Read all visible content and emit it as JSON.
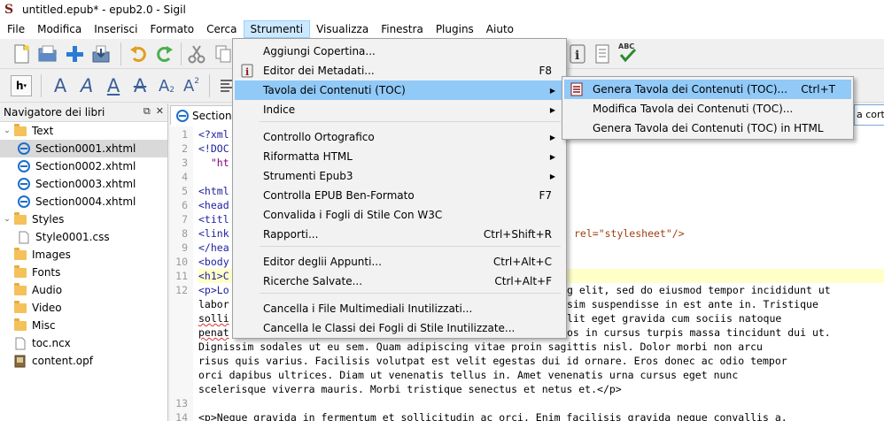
{
  "window": {
    "title": "untitled.epub* - epub2.0 - Sigil"
  },
  "menubar": [
    "File",
    "Modifica",
    "Inserisci",
    "Formato",
    "Cerca",
    "Strumenti",
    "Visualizza",
    "Finestra",
    "Plugins",
    "Aiuto"
  ],
  "active_menu": "Strumenti",
  "strumenti_menu": [
    {
      "label": "Aggiungi Copertina...",
      "shortcut": "",
      "submenu": false,
      "icon": ""
    },
    {
      "label": "Editor dei Metadati...",
      "shortcut": "F8",
      "submenu": false,
      "icon": "info-icon"
    },
    {
      "label": "Tavola dei Contenuti (TOC)",
      "shortcut": "",
      "submenu": true,
      "icon": ""
    },
    {
      "label": "Indice",
      "shortcut": "",
      "submenu": true,
      "icon": ""
    },
    {
      "label": "Controllo Ortografico",
      "shortcut": "",
      "submenu": true,
      "icon": ""
    },
    {
      "label": "Riformatta HTML",
      "shortcut": "",
      "submenu": true,
      "icon": ""
    },
    {
      "label": "Strumenti Epub3",
      "shortcut": "",
      "submenu": true,
      "icon": ""
    },
    {
      "label": "Controlla EPUB Ben-Formato",
      "shortcut": "F7",
      "submenu": false,
      "icon": ""
    },
    {
      "label": "Convalida i Fogli di Stile Con W3C",
      "shortcut": "",
      "submenu": false,
      "icon": ""
    },
    {
      "label": "Rapporti...",
      "shortcut": "Ctrl+Shift+R",
      "submenu": false,
      "icon": ""
    },
    {
      "label": "Editor deglii Appunti...",
      "shortcut": "Ctrl+Alt+C",
      "submenu": false,
      "icon": ""
    },
    {
      "label": "Ricerche Salvate...",
      "shortcut": "Ctrl+Alt+F",
      "submenu": false,
      "icon": ""
    },
    {
      "label": "Cancella i File Multimediali Inutilizzati...",
      "shortcut": "",
      "submenu": false,
      "icon": ""
    },
    {
      "label": "Cancella le Classi dei Fogli di Stile Inutilizzate...",
      "shortcut": "",
      "submenu": false,
      "icon": ""
    }
  ],
  "toc_submenu": [
    {
      "label": "Genera Tavola dei Contenuti (TOC)...",
      "shortcut": "Ctrl+T",
      "icon": "toc-icon"
    },
    {
      "label": "Modifica Tavola dei Contenuti (TOC)...",
      "shortcut": ""
    },
    {
      "label": "Genera Tavola dei Contenuti (TOC) in HTML",
      "shortcut": ""
    }
  ],
  "navigator": {
    "title": "Navigatore dei libri",
    "items": [
      {
        "label": "Text",
        "type": "folder",
        "level": 0,
        "expanded": true
      },
      {
        "label": "Section0001.xhtml",
        "type": "xhtml",
        "level": 1,
        "selected": true
      },
      {
        "label": "Section0002.xhtml",
        "type": "xhtml",
        "level": 1
      },
      {
        "label": "Section0003.xhtml",
        "type": "xhtml",
        "level": 1
      },
      {
        "label": "Section0004.xhtml",
        "type": "xhtml",
        "level": 1
      },
      {
        "label": "Styles",
        "type": "folder",
        "level": 0,
        "expanded": true
      },
      {
        "label": "Style0001.css",
        "type": "css",
        "level": 1
      },
      {
        "label": "Images",
        "type": "folder",
        "level": 0
      },
      {
        "label": "Fonts",
        "type": "folder",
        "level": 0
      },
      {
        "label": "Audio",
        "type": "folder",
        "level": 0
      },
      {
        "label": "Video",
        "type": "folder",
        "level": 0
      },
      {
        "label": "Misc",
        "type": "folder",
        "level": 0
      },
      {
        "label": "toc.ncx",
        "type": "ncx",
        "level": 0
      },
      {
        "label": "content.opf",
        "type": "opf",
        "level": 0
      }
    ]
  },
  "editor": {
    "tab_label": "Section",
    "search_stub": "a corte",
    "line_numbers": [
      "1",
      "2",
      "3",
      "4",
      "5",
      "6",
      "7",
      "8",
      "9",
      "10",
      "11",
      "12",
      "",
      "",
      "",
      "",
      "",
      "",
      "",
      "13",
      "14"
    ],
    "visible_code": {
      "l1": "<?xml",
      "l2": "<!DOC",
      "l3": "  \"ht",
      "l5": "<html",
      "l6": "<head",
      "l7": "<titl",
      "l8a": "<link",
      "l8b": "rel=\"stylesheet\"/>",
      "l9": "</hea",
      "l10": "<body",
      "l11": "<h1>C",
      "l12a": "<p>Lo",
      "l12b": "g elit, sed do eiusmod tempor incididunt ut",
      "l12c": "labor",
      "l12d": "sim suspendisse in est ante in. Tristique",
      "l12e": "solli",
      "l12f": "lit eget gravida cum sociis natoque",
      "l12g": "penat",
      "l12h": "os in cursus turpis massa tincidunt dui ut.",
      "l12i": "Dignissim sodales ut eu sem. Quam adipiscing vitae proin sagittis nisl. Dolor morbi non arcu",
      "l12j": "risus quis varius. Facilisis volutpat est velit egestas dui id ornare. Eros donec ac odio tempor",
      "l12k": "orci dapibus ultrices. Diam ut venenatis tellus in. Amet venenatis urna cursus eget nunc",
      "l12l": "scelerisque viverra mauris. Morbi tristique senectus et netus et.</p>",
      "l14": "<p>Neque gravida in fermentum et sollicitudin ac orci. Enim facilisis gravida neque convallis a."
    }
  },
  "colors": {
    "menu_hover": "#91c9f7",
    "menubar_active": "#cce8ff",
    "highlight_line": "#ffffc8"
  }
}
